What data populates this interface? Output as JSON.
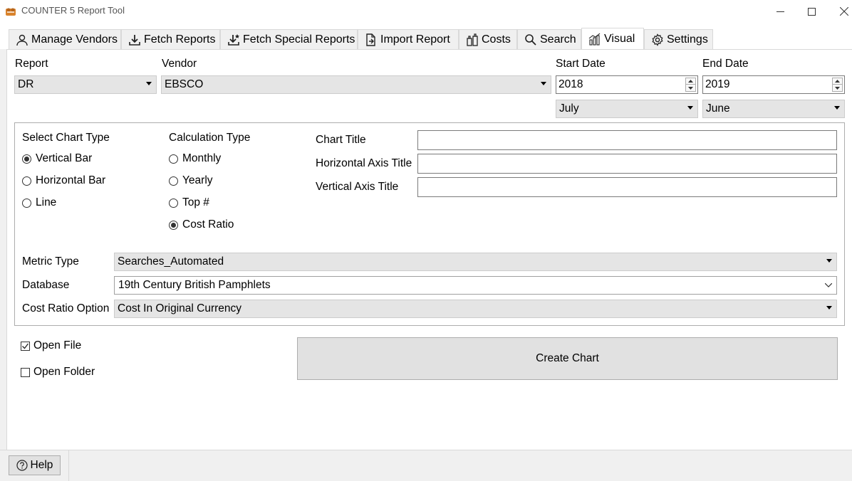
{
  "window": {
    "title": "COUNTER 5 Report Tool"
  },
  "tabs": [
    {
      "label": "Manage Vendors",
      "icon": "user-icon"
    },
    {
      "label": "Fetch Reports",
      "icon": "download-icon"
    },
    {
      "label": "Fetch Special Reports",
      "icon": "download-special-icon"
    },
    {
      "label": "Import Report",
      "icon": "import-file-icon"
    },
    {
      "label": "Costs",
      "icon": "costs-icon"
    },
    {
      "label": "Search",
      "icon": "search-icon"
    },
    {
      "label": "Visual",
      "icon": "chart-icon",
      "active": true
    },
    {
      "label": "Settings",
      "icon": "gear-icon"
    }
  ],
  "filters": {
    "report_label": "Report",
    "report_value": "DR",
    "vendor_label": "Vendor",
    "vendor_value": "EBSCO",
    "start_label": "Start Date",
    "start_year": "2018",
    "start_month": "July",
    "end_label": "End Date",
    "end_year": "2019",
    "end_month": "June"
  },
  "chart_type": {
    "heading": "Select Chart Type",
    "options": [
      "Vertical Bar",
      "Horizontal Bar",
      "Line"
    ],
    "selected": "Vertical Bar"
  },
  "calc_type": {
    "heading": "Calculation Type",
    "options": [
      "Monthly",
      "Yearly",
      "Top #",
      "Cost Ratio"
    ],
    "selected": "Cost Ratio"
  },
  "titles": {
    "chart_title_label": "Chart Title",
    "horizontal_label": "Horizontal Axis Title",
    "vertical_label": "Vertical Axis Title",
    "chart_title_value": "",
    "horizontal_value": "",
    "vertical_value": ""
  },
  "options": {
    "metric_label": "Metric Type",
    "metric_value": "Searches_Automated",
    "database_label": "Database",
    "database_value": "19th Century British Pamphlets",
    "cost_ratio_label": "Cost Ratio Option",
    "cost_ratio_value": "Cost In Original Currency"
  },
  "checks": {
    "open_file_label": "Open File",
    "open_file_checked": true,
    "open_folder_label": "Open Folder",
    "open_folder_checked": false
  },
  "actions": {
    "create_chart": "Create Chart",
    "help": "Help"
  }
}
